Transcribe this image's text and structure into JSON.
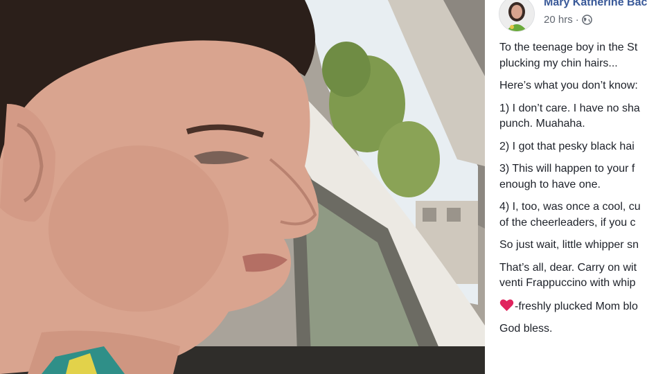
{
  "post": {
    "author_name": "Mary Katherine Bac",
    "timestamp": "20 hrs",
    "separator": "·",
    "privacy_icon": "globe-icon",
    "avatar_icon": "profile-photo",
    "paragraphs": [
      {
        "lines": [
          "To the teenage boy in the St",
          "plucking my chin hairs..."
        ]
      },
      {
        "lines": [
          "Here’s what you don’t know:"
        ]
      },
      {
        "lines": [
          "1) I don’t care. I have no sha",
          "punch. Muahaha."
        ]
      },
      {
        "lines": [
          "2) I got that pesky black hai"
        ]
      },
      {
        "lines": [
          "3) This will happen to your f",
          "enough to have one."
        ]
      },
      {
        "lines": [
          "4) I, too, was once a cool, cu",
          "of the cheerleaders, if you c"
        ]
      },
      {
        "lines": [
          "So just wait, little whipper sn"
        ]
      },
      {
        "lines": [
          "That’s all, dear. Carry on wit",
          "venti Frappuccino with whip"
        ]
      }
    ],
    "signoff": {
      "emoji": "heart-icon",
      "text": "-freshly plucked Mom blo"
    },
    "closing": "God bless."
  },
  "photo": {
    "description_icon": "selfie-photo"
  },
  "colors": {
    "author": "#385898",
    "meta": "#616770",
    "body_text": "#1d2129",
    "heart": "#e0245e"
  }
}
